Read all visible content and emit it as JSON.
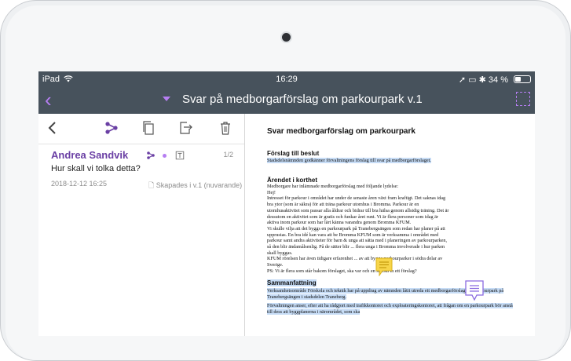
{
  "status_bar": {
    "device": "iPad",
    "time": "16:29",
    "battery": "34 %"
  },
  "title_bar": {
    "title": "Svar på medborgarförslag om parkourpark  v.1"
  },
  "comment": {
    "author": "Andrea Sandvik",
    "subject": "Hur skall vi tolka detta?",
    "date": "2018-12-12 16:25",
    "status": "Skapades i v.1 (nuvarande)",
    "count": "1/2",
    "accent": "#6a3fa4"
  },
  "document": {
    "title": "Svar medborgarförslag om parkourpark",
    "section1_heading": "Förslag till beslut",
    "section1_text": "Stadsdelsnämnden godkänner förvaltningens förslag till svar på medborgarförslaget.",
    "section2_heading": "Ärendet i korthet",
    "section2_lines": [
      "Medborgare har inlämnade medborgarförslag med följande lydelse:",
      "Hej!",
      "Intresset för parkour i området har under de senaste åren växt fram kraftigt. Det saknas idag",
      "bra ytor (som är säkra) för att träna parkour utomhus i Bromma. Parkour är en",
      "utomhusaktivitet som passar alla åldrar och bidrar till bra hälsa genom allsidig träning. Det är",
      "dessutom en aktivitet som är gratis och funkar året runt. Vi är flera personer som idag är",
      "aktiva inom parkour som har lärt känna varandra genom Bromma KFUM.",
      "Vi skulle vilja att det byggs en parkourpark på Tranebergsängen som redan har planer på att",
      "upprustas. En bra idé kan vara att be Bromma KFUM som är verksamma i området med",
      "parkour samt andra aktiviteter för barn & unga att sätta med i planeringen av parkourparken,",
      "så den blir ändamålsenlig. På de sätter blir ... flera unga i Bromma involverade i hur parken",
      "skall byggas.",
      "KFUM rörelsen har även tidigare erfarenhet ... av att bygga parkourparker i södra delar av",
      "Sverige.",
      "PS: Vi är flera som står bakom förslaget, ska var och en skicka in ett förslag?"
    ],
    "section3_heading": "Sammanfattning",
    "section3_text1": "Verksamhetsområde Förskola och teknik har på uppdrag av nämnden låtit utreda ett medborgarförslag om parkourpark på Tranebergsängen i stadsdelen Traneberg.",
    "section3_text2": "Förvaltningen anser, efter att ha rådgjort med trafikkontoret och exploateringskontoret, att frågan om en parkourpark bör anstå till dess att byggplanerna i närområdet, som ska"
  },
  "colors": {
    "bar": "#47525c",
    "accent": "#b67ef2",
    "highlight": "#c6dcf6",
    "note_yellow": "#f7d54a",
    "note_purple": "#8a6ae0"
  }
}
